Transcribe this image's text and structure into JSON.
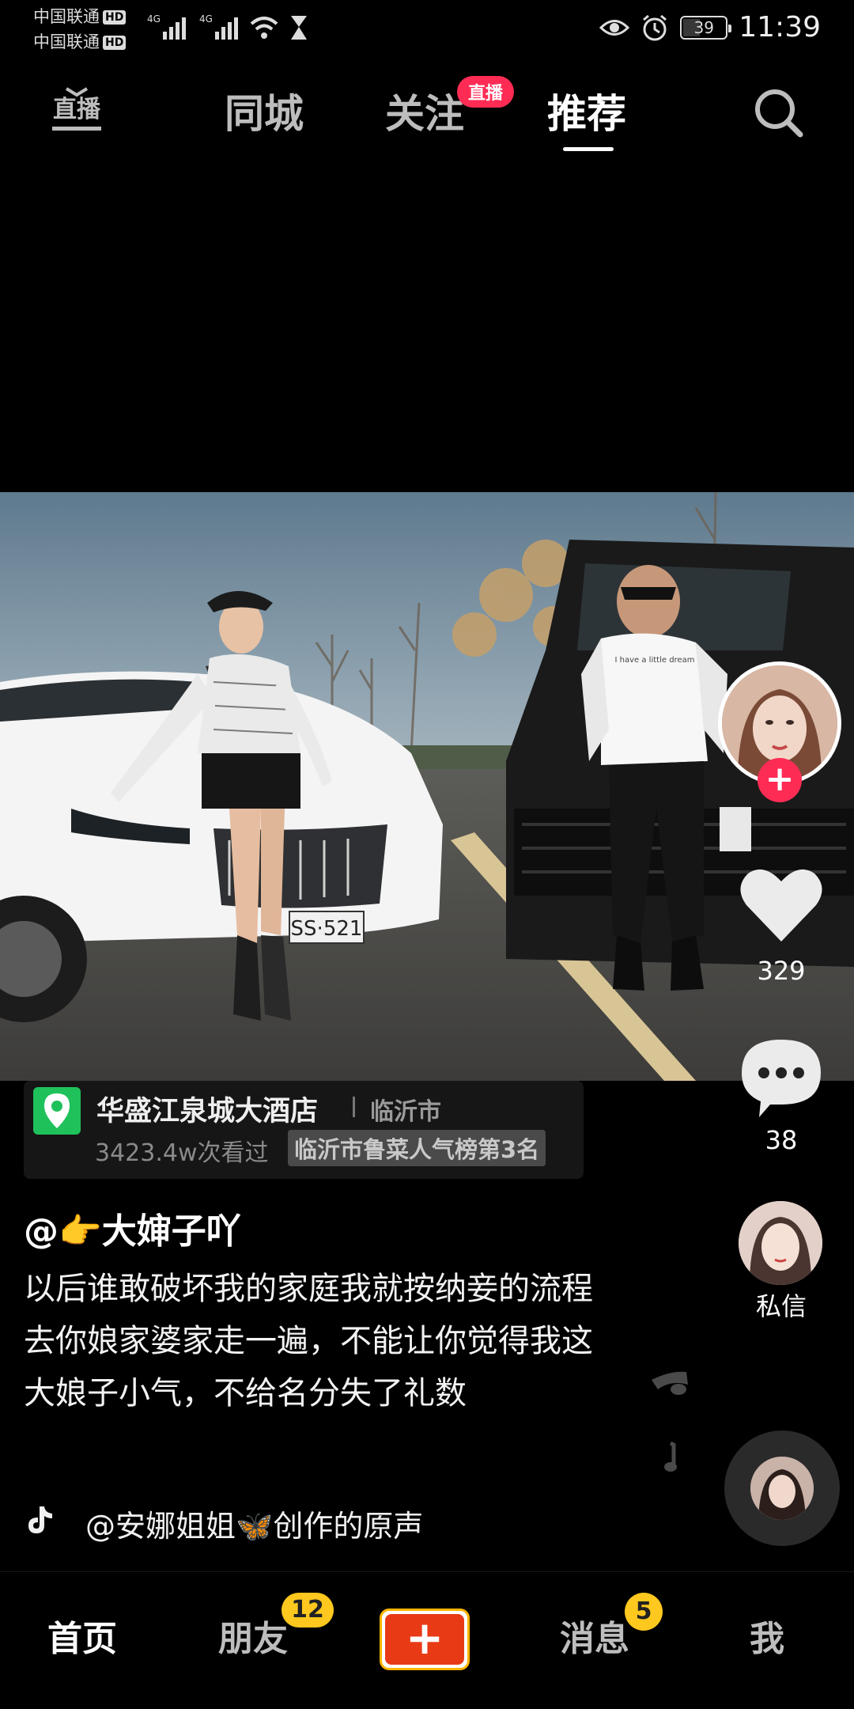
{
  "status_bar": {
    "carrier_1": "中国联通",
    "carrier_2": "中国联通",
    "hd": "HD",
    "network": "4G",
    "battery": "39",
    "battery_level": 0.39,
    "time": "11:39"
  },
  "top_nav": {
    "live_label": "直播",
    "tabs": [
      "同城",
      "关注",
      "推荐"
    ],
    "active_tab": "推荐",
    "live_badge": "直播"
  },
  "video": {
    "plate": "SS·521",
    "shirt_text": "I have a little dream"
  },
  "right_rail": {
    "like_count": "329",
    "comment_count": "38",
    "dm_label": "私信"
  },
  "location": {
    "name": "华盛江泉城大酒店",
    "city": "临沂市",
    "views": "3423.4w次看过",
    "rank": "临沂市鲁菜人气榜第3名"
  },
  "post": {
    "author": "@👉大婶子吖",
    "caption": "以后谁敢破坏我的家庭我就按纳妾的流程去你娘家婆家走一遍，不能让你觉得我这大娘子小气，不给名分失了礼数",
    "music": "@安娜姐姐🦋创作的原声"
  },
  "bottom_nav": {
    "home": "首页",
    "friends": "朋友",
    "friends_badge": "12",
    "messages": "消息",
    "messages_badge": "5",
    "me": "我"
  },
  "colors": {
    "accent": "#fe2c55",
    "badge": "#ffc81e",
    "location_pin": "#1fc15b"
  }
}
